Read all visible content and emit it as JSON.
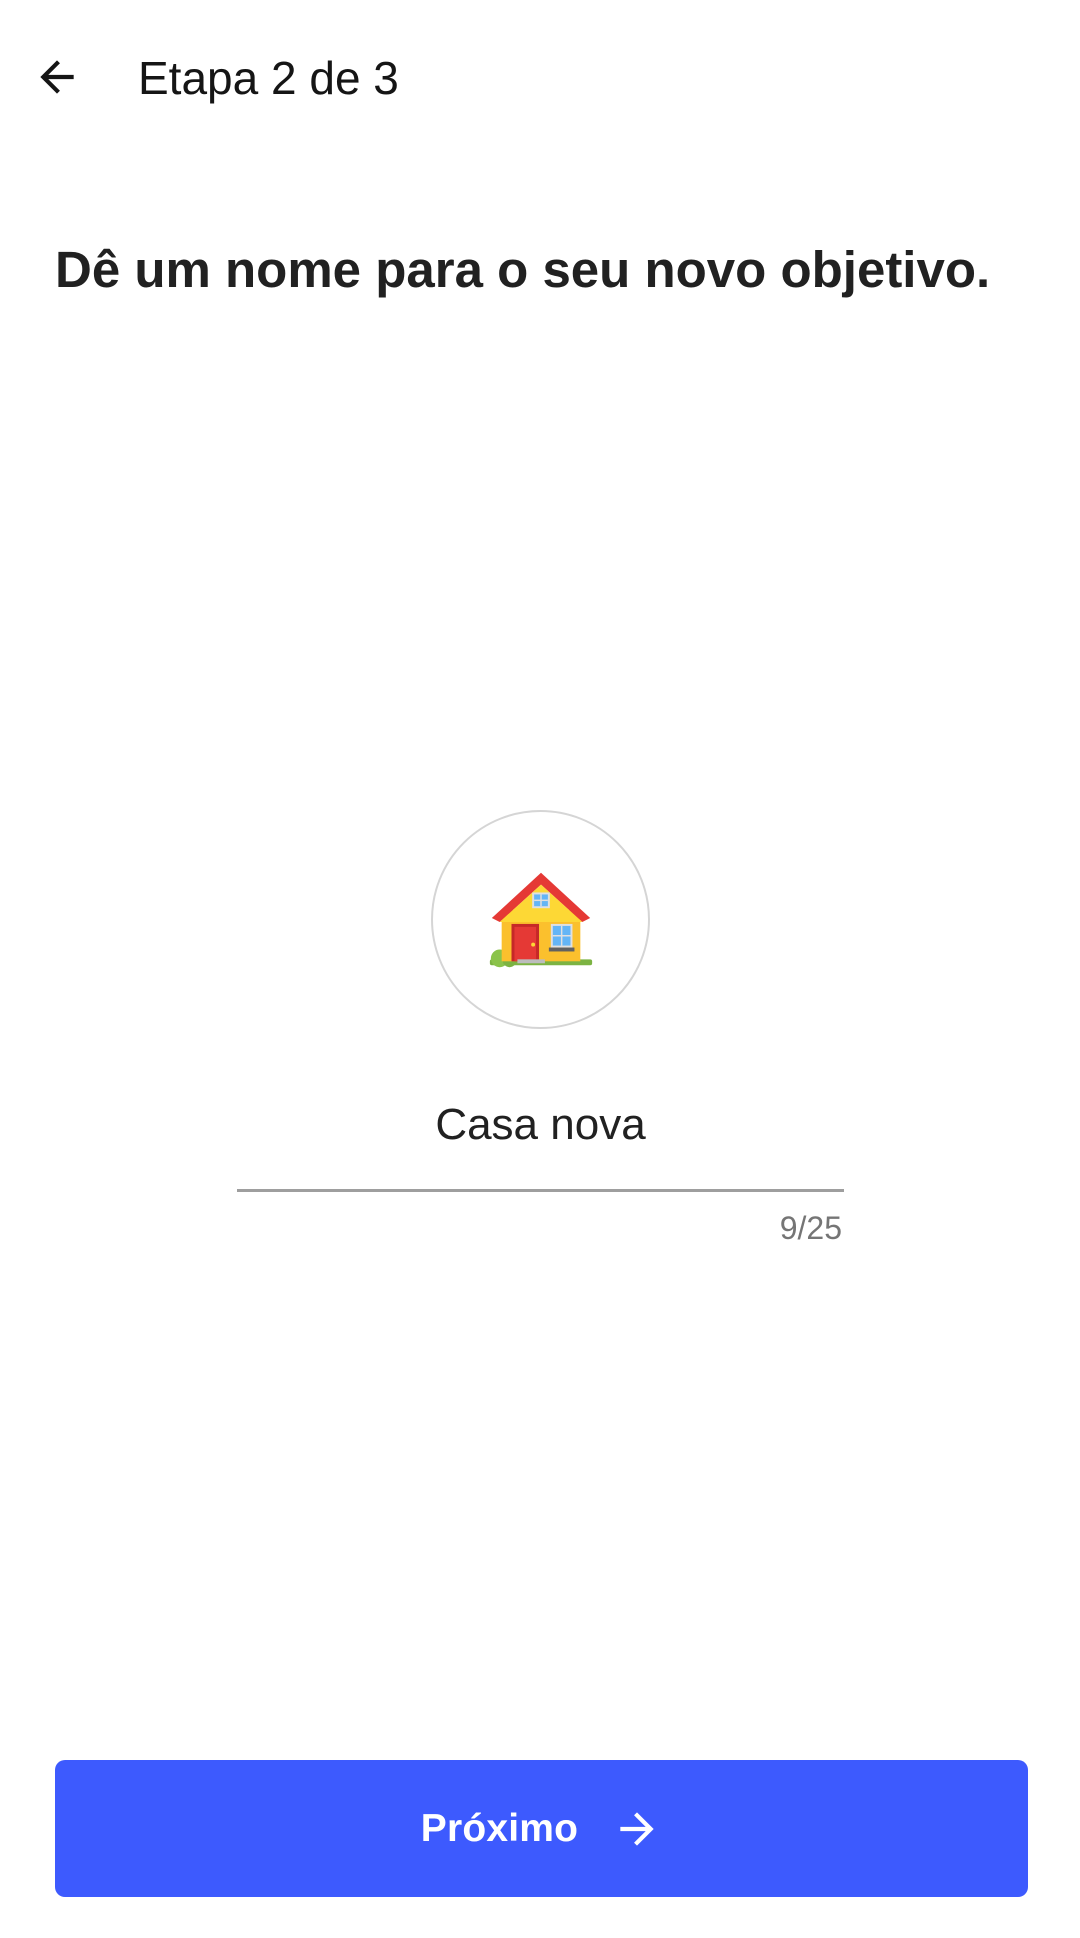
{
  "app_bar": {
    "back_icon": "arrow-left-icon",
    "title": "Etapa 2 de 3"
  },
  "heading": "Dê um nome para o seu novo objetivo.",
  "goal": {
    "emoji_icon": "house-icon",
    "name_value": "Casa nova",
    "char_counter": "9/25"
  },
  "next_button": {
    "label": "Próximo",
    "icon": "arrow-right-icon",
    "color": "#3d5afe"
  }
}
